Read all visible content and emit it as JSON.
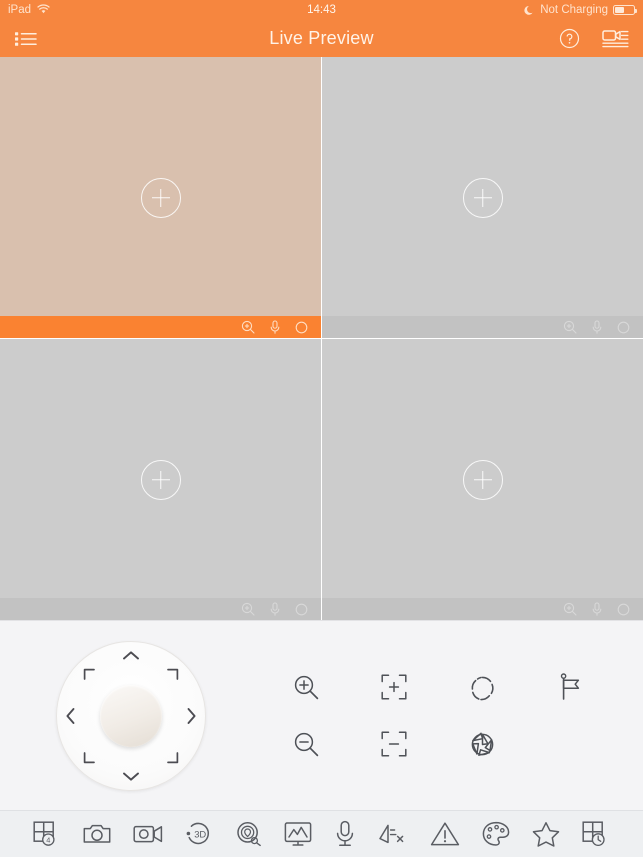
{
  "status_bar": {
    "device": "iPad",
    "wifi_icon": "wifi-icon",
    "time": "14:43",
    "charging_icon": "crescent-moon-icon",
    "battery_text": "Not Charging",
    "battery_icon": "battery-icon",
    "battery_level_pct": 45
  },
  "nav_bar": {
    "title": "Live Preview",
    "menu_icon": "list-menu-icon",
    "help_icon": "question-circle-icon",
    "device_icon": "camcorder-list-icon",
    "background_color": "#f6863f"
  },
  "video_grid": {
    "layout": "2x2",
    "panels": [
      {
        "index": 1,
        "selected": true,
        "background_color": "#d9c0ae",
        "add_label": "+",
        "toolbar_color": "#fa8231",
        "toolbar_icons": [
          "digital-zoom-icon",
          "microphone-icon",
          "record-icon"
        ]
      },
      {
        "index": 2,
        "selected": false,
        "background_color": "#cccccc",
        "add_label": "+",
        "toolbar_color": "#c2c2c2",
        "toolbar_icons": [
          "digital-zoom-icon",
          "microphone-icon",
          "record-icon"
        ]
      },
      {
        "index": 3,
        "selected": false,
        "background_color": "#cccccc",
        "add_label": "+",
        "toolbar_color": "#c2c2c2",
        "toolbar_icons": [
          "digital-zoom-icon",
          "microphone-icon",
          "record-icon"
        ]
      },
      {
        "index": 4,
        "selected": false,
        "background_color": "#cccccc",
        "add_label": "+",
        "toolbar_color": "#c2c2c2",
        "toolbar_icons": [
          "digital-zoom-icon",
          "microphone-icon",
          "record-icon"
        ]
      }
    ]
  },
  "ptz": {
    "dpad_name": "ptz-direction-pad",
    "directions": [
      "up",
      "up-right",
      "right",
      "down-right",
      "down",
      "down-left",
      "left",
      "up-left"
    ],
    "center_knob": "ptz-center-knob",
    "functions": [
      {
        "name": "zoom-in-button",
        "icon": "magnifier-plus-icon"
      },
      {
        "name": "focus-near-button",
        "icon": "focus-plus-icon"
      },
      {
        "name": "iris-open-button",
        "icon": "iris-open-icon"
      },
      {
        "name": "preset-button",
        "icon": "flag-icon"
      },
      {
        "name": "zoom-out-button",
        "icon": "magnifier-minus-icon"
      },
      {
        "name": "focus-far-button",
        "icon": "focus-minus-icon"
      },
      {
        "name": "iris-close-button",
        "icon": "iris-close-icon"
      }
    ]
  },
  "bottom_toolbar": {
    "items": [
      {
        "name": "window-division-button",
        "icon": "grid-4-icon",
        "badge": "4"
      },
      {
        "name": "capture-button",
        "icon": "camera-icon"
      },
      {
        "name": "record-button",
        "icon": "video-camera-icon"
      },
      {
        "name": "three-d-position-button",
        "icon": "three-d-icon",
        "badge": "3D"
      },
      {
        "name": "ptz-control-button",
        "icon": "ptz-control-icon"
      },
      {
        "name": "image-settings-button",
        "icon": "picture-monitor-icon"
      },
      {
        "name": "two-way-audio-button",
        "icon": "microphone-icon"
      },
      {
        "name": "audio-mute-button",
        "icon": "speaker-mute-icon"
      },
      {
        "name": "alarm-output-button",
        "icon": "warning-triangle-icon"
      },
      {
        "name": "image-quality-button",
        "icon": "palette-icon"
      },
      {
        "name": "favorites-button",
        "icon": "star-icon"
      },
      {
        "name": "history-layout-button",
        "icon": "grid-clock-icon"
      }
    ]
  },
  "colors": {
    "accent_orange": "#f6863f",
    "toolbar_orange": "#fa8231",
    "panel_gray": "#cccccc",
    "panel_beige": "#d9c0ae",
    "icon_gray": "#5a5d63"
  }
}
